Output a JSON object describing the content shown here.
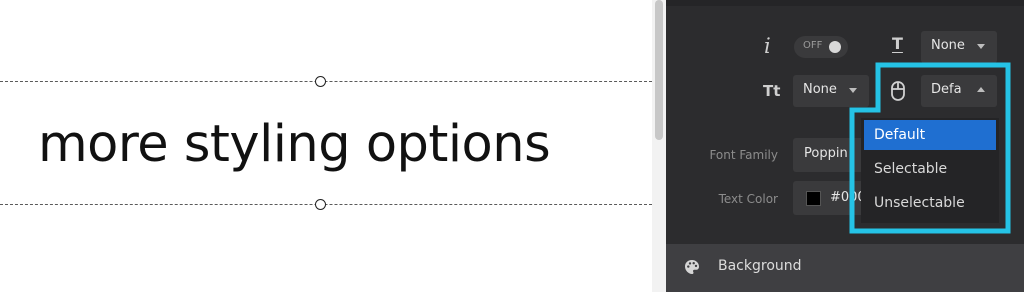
{
  "canvas": {
    "heading_text": "more styling options"
  },
  "panel": {
    "italic_icon": "i",
    "toggle_label": "OFF",
    "underline_icon": "T",
    "underline_value": "None",
    "texttransform_icon": "Tt",
    "texttransform_value": "None",
    "cursor_value": "Defa",
    "font_family_label": "Font Family",
    "font_family_value": "Poppin",
    "text_color_label": "Text Color",
    "text_color_value": "#000",
    "background_section": "Background"
  },
  "dropdown": {
    "options": [
      "Default",
      "Selectable",
      "Unselectable"
    ],
    "selected": "Default"
  },
  "colors": {
    "panel_bg": "#2c2c2e",
    "highlight": "#25c3e6",
    "selected_option": "#1f6fd1"
  }
}
